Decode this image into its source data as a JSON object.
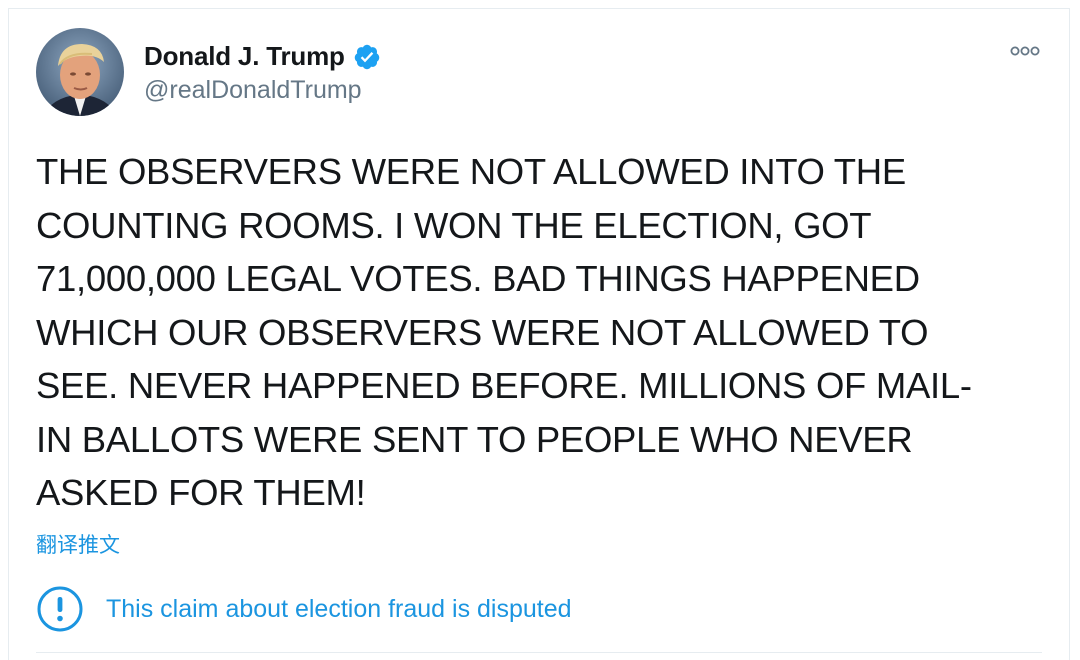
{
  "author": {
    "display_name": "Donald J. Trump",
    "handle": "@realDonaldTrump",
    "verified": true,
    "avatar_icon": "profile-photo"
  },
  "tweet": {
    "text": "THE OBSERVERS WERE NOT ALLOWED INTO THE\nCOUNTING ROOMS. I WON THE ELECTION, GOT\n71,000,000 LEGAL VOTES. BAD THINGS HAPPENED\nWHICH OUR OBSERVERS WERE NOT ALLOWED TO\nSEE. NEVER HAPPENED BEFORE. MILLIONS OF MAIL-\nIN BALLOTS WERE SENT TO PEOPLE WHO NEVER\nASKED FOR THEM!",
    "translate_label": "翻译推文"
  },
  "notice": {
    "icon": "exclamation-circle-icon",
    "text": "This claim about election fraud is disputed"
  },
  "menu": {
    "icon": "more-options-icon"
  },
  "colors": {
    "link": "#1b95e0",
    "verified": "#1da1f2",
    "text": "#14171a",
    "secondary": "#657786",
    "border": "#e6ecf0"
  }
}
